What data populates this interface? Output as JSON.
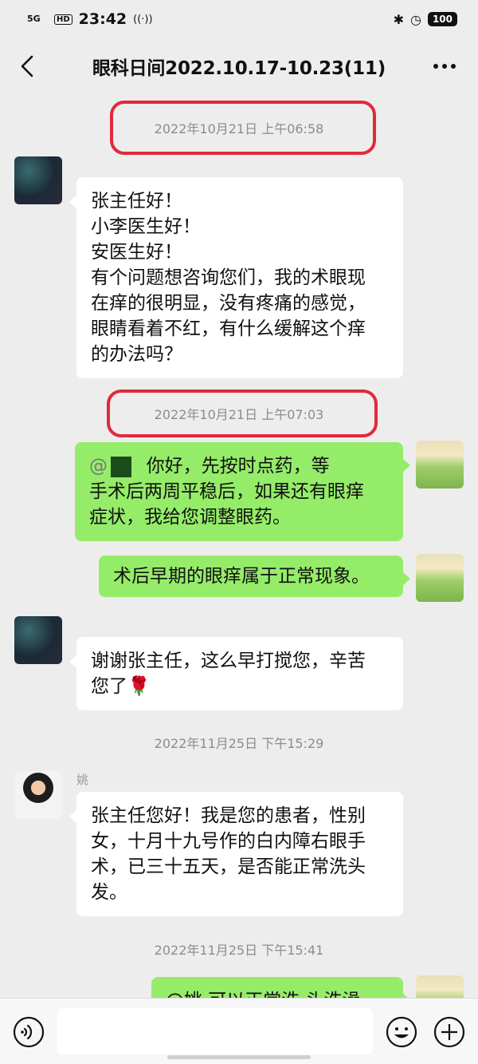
{
  "status_bar": {
    "signal": "5G",
    "hd": "HD",
    "time": "23:42",
    "battery": "100"
  },
  "header": {
    "title": "眼科日间2022.10.17-10.23(11)"
  },
  "messages": [
    {
      "timestamp": "2022年10月21日  上午06:58",
      "sender": "",
      "lines": [
        "张主任好！",
        "小李医生好！",
        "安医生好！",
        "有个问题想咨询您们，我的术眼现",
        "在痒的很明显，没有疼痛的感觉，",
        "眼睛看着不红，有什么缓解这个痒",
        "的办法吗？"
      ]
    },
    {
      "timestamp": "2022年10月21日  上午07:03",
      "line1_text": "你好，先按时点药，等",
      "lines": [
        "手术后两周平稳后，如果还有眼痒",
        "症状，我给您调整眼药。"
      ]
    },
    {
      "text": "术后早期的眼痒属于正常现象。"
    },
    {
      "lines": [
        "谢谢张主任，这么早打搅您，辛苦",
        "您了"
      ]
    },
    {
      "timestamp": "2022年11月25日  下午15:29",
      "sender": "姚",
      "lines": [
        "张主任您好！我是您的患者，性别",
        "女，十月十九号作的白内障右眼手",
        "术，已三十五天，是否能正常洗头",
        "发。"
      ]
    },
    {
      "timestamp": "2022年11月25日  下午15:41",
      "partial": "@姚  可以正常洗 头洗澡"
    }
  ],
  "icons": {
    "back": "back-arrow-icon",
    "more": "more-icon",
    "voice": "voice-icon",
    "emoji": "emoji-icon",
    "plus": "plus-icon",
    "rose": "rose-emoji"
  },
  "colors": {
    "background": "#ededed",
    "bubble_in": "#ffffff",
    "bubble_out": "#95ec69",
    "highlight": "#e02a3a"
  }
}
